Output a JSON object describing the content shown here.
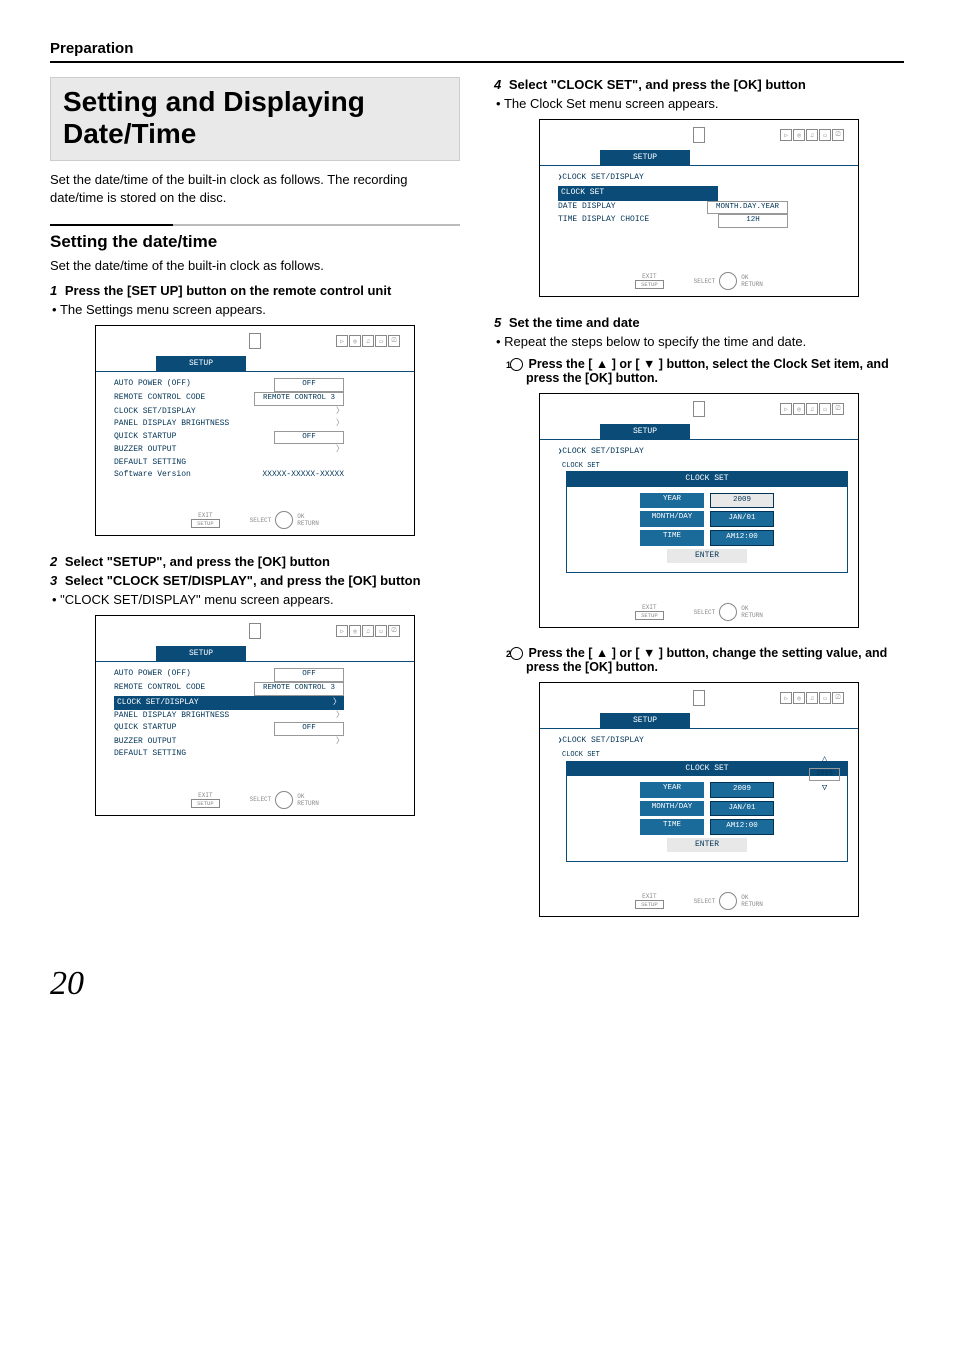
{
  "header": {
    "section": "Preparation"
  },
  "title": "Setting and Displaying Date/Time",
  "intro": "Set the date/time of the built-in clock as follows. The recording date/time is stored on the disc.",
  "subheading": "Setting the date/time",
  "sub_desc": "Set the date/time of the built-in clock as follows.",
  "steps": {
    "s1": {
      "n": "1",
      "t": "Press the [SET UP] button on the remote control unit"
    },
    "s1_note": "The Settings menu screen appears.",
    "s2": {
      "n": "2",
      "t": "Select \"SETUP\", and press the [OK] button"
    },
    "s3": {
      "n": "3",
      "t": "Select \"CLOCK SET/DISPLAY\", and press the [OK] button"
    },
    "s3_note": "\"CLOCK SET/DISPLAY\" menu screen appears.",
    "s4": {
      "n": "4",
      "t": "Select \"CLOCK SET\", and press the [OK] button"
    },
    "s4_note": "The Clock Set menu screen appears.",
    "s5": {
      "n": "5",
      "t": "Set the time and date"
    },
    "s5_note": "Repeat the steps below to specify the time and date.",
    "s5a": "Press the [ ▲ ] or [ ▼ ] button, select the Clock Set item, and press the [OK] button.",
    "s5b": "Press the [ ▲ ] or [ ▼ ] button, change the setting value, and press the [OK] button."
  },
  "menu": {
    "tab": "SETUP",
    "rows": {
      "auto_power": "AUTO POWER (OFF)",
      "auto_power_v": "OFF",
      "remote": "REMOTE CONTROL CODE",
      "remote_v": "REMOTE CONTROL 3",
      "clock": "CLOCK SET/DISPLAY",
      "panel": "PANEL DISPLAY BRIGHTNESS",
      "quick": "QUICK STARTUP",
      "quick_v": "OFF",
      "buzzer": "BUZZER OUTPUT",
      "default": "DEFAULT SETTING",
      "sw": "Software Version",
      "sw_v": "XXXXX-XXXXX-XXXXX"
    },
    "footer": {
      "exit": "EXIT",
      "setup": "SETUP",
      "select": "SELECT",
      "ok": "OK",
      "return": "RETURN"
    }
  },
  "menu2": {
    "crumb": "CLOCK SET/DISPLAY",
    "clock_set": "CLOCK SET",
    "date_disp": "DATE DISPLAY",
    "date_disp_v": "MONTH.DAY.YEAR",
    "time_choice": "TIME DISPLAY CHOICE",
    "time_choice_v": "12H"
  },
  "clockset": {
    "crumb": "CLOCK SET/DISPLAY",
    "title": "CLOCK SET",
    "row_parent": "CLOCK SET",
    "year": "YEAR",
    "year_v": "2009",
    "md": "MONTH/DAY",
    "md_v": "JAN/01",
    "time": "TIME",
    "time_v": "AM12:00",
    "enter": "ENTER"
  },
  "page_number": "20"
}
